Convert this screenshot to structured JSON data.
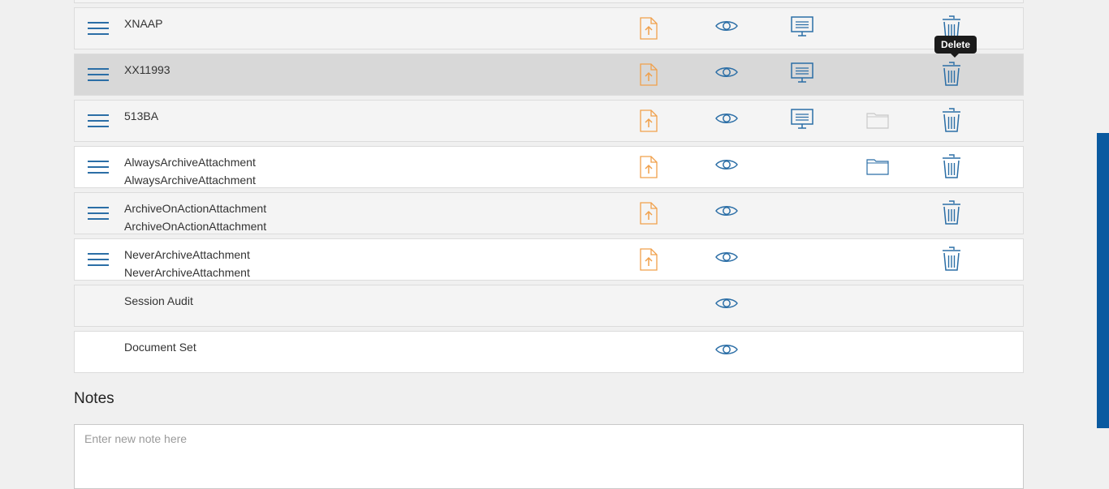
{
  "rows": [
    {
      "lines": [
        "XNAAP"
      ],
      "draggable": true,
      "upload": true,
      "view": true,
      "present": true,
      "folder": "none",
      "delete": true
    },
    {
      "lines": [
        "XX11993"
      ],
      "draggable": true,
      "upload": true,
      "view": true,
      "present": true,
      "folder": "none",
      "delete": true
    },
    {
      "lines": [
        "513BA"
      ],
      "draggable": true,
      "upload": true,
      "view": true,
      "present": true,
      "folder": "disabled",
      "delete": true
    },
    {
      "lines": [
        "AlwaysArchiveAttachment",
        "AlwaysArchiveAttachment"
      ],
      "draggable": true,
      "upload": true,
      "view": true,
      "present": false,
      "folder": "active",
      "delete": true
    },
    {
      "lines": [
        "ArchiveOnActionAttachment",
        "ArchiveOnActionAttachment"
      ],
      "draggable": true,
      "upload": true,
      "view": true,
      "present": false,
      "folder": "none",
      "delete": true
    },
    {
      "lines": [
        "NeverArchiveAttachment",
        "NeverArchiveAttachment"
      ],
      "draggable": true,
      "upload": true,
      "view": true,
      "present": false,
      "folder": "none",
      "delete": true
    },
    {
      "lines": [
        "Session Audit"
      ],
      "draggable": false,
      "upload": false,
      "view": true,
      "present": false,
      "folder": "none",
      "delete": false
    },
    {
      "lines": [
        "Document Set"
      ],
      "draggable": false,
      "upload": false,
      "view": true,
      "present": false,
      "folder": "none",
      "delete": false
    }
  ],
  "tooltip": {
    "text": "Delete"
  },
  "notes": {
    "title": "Notes",
    "placeholder": "Enter new note here",
    "value": ""
  },
  "colors": {
    "accent": "#2b6ea6",
    "upload": "#f0a04b",
    "hover_row": "#d8d8d8",
    "scrollbar": "#0a5aa0",
    "folder_disabled": "#c8c8c8"
  },
  "icons": {
    "handle": "drag-handle-icon",
    "upload": "upload-file-icon",
    "view": "eye-icon",
    "present": "presentation-icon",
    "folder": "folder-icon",
    "delete": "trash-icon"
  }
}
